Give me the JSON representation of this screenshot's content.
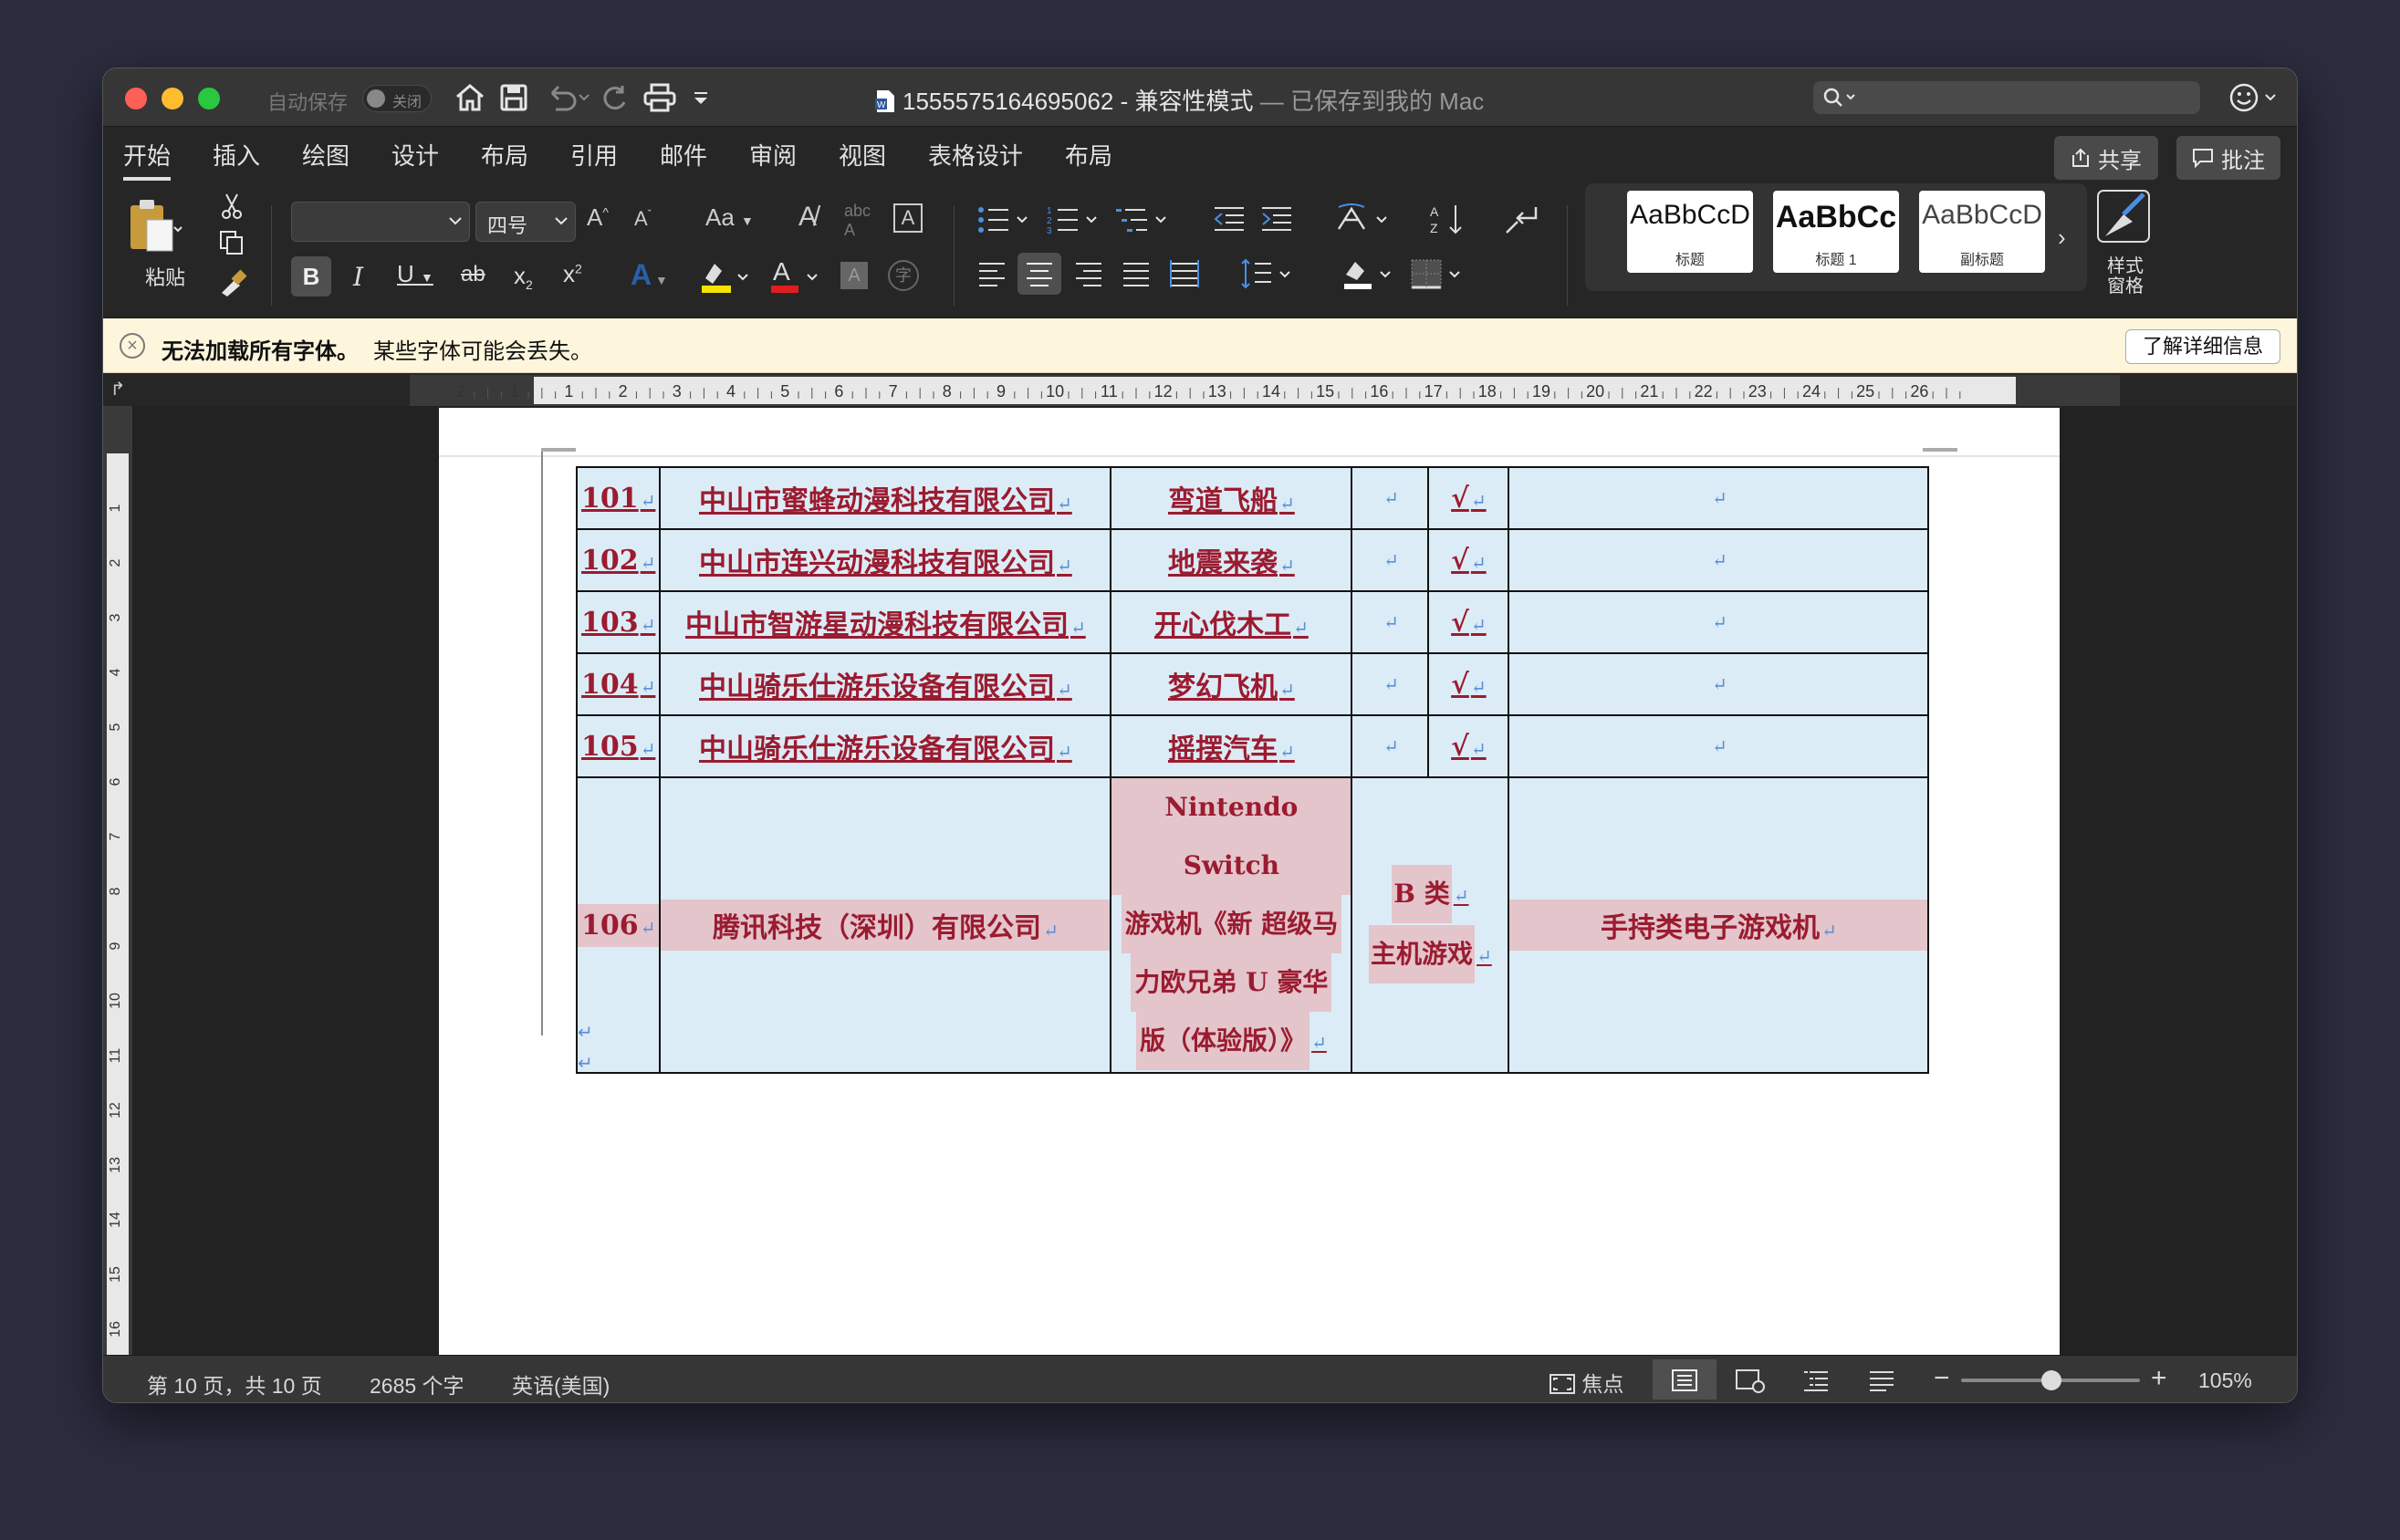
{
  "titlebar": {
    "autosave_label": "自动保存",
    "autosave_state": "关闭",
    "filename": "1555575164695062",
    "mode": "兼容性模式",
    "saved_status": "— 已保存到我的 Mac"
  },
  "tabs": [
    "开始",
    "插入",
    "绘图",
    "设计",
    "布局",
    "引用",
    "邮件",
    "审阅",
    "视图",
    "表格设计",
    "布局"
  ],
  "actions": {
    "share": "共享",
    "comment": "批注"
  },
  "ribbon": {
    "paste_label": "粘贴",
    "font_name": "",
    "font_size": "四号",
    "styles": [
      {
        "sample": "AaBbCcD",
        "name": "标题"
      },
      {
        "sample": "AaBbCc",
        "name": "标题 1"
      },
      {
        "sample": "AaBbCcD",
        "name": "副标题"
      }
    ],
    "styles_pane_label": "样式\n窗格"
  },
  "notice": {
    "title": "无法加载所有字体。",
    "message": "某些字体可能会丢失。",
    "button": "了解详细信息"
  },
  "ruler_numbers": [
    "2",
    "1",
    "1",
    "2",
    "3",
    "4",
    "5",
    "6",
    "7",
    "8",
    "9",
    "10",
    "11",
    "12",
    "13",
    "14",
    "15",
    "16",
    "17",
    "18",
    "19",
    "20",
    "21",
    "22",
    "23",
    "24",
    "25",
    "26"
  ],
  "table": {
    "rows": [
      {
        "no": "101",
        "company": "中山市蜜蜂动漫科技有限公司",
        "product": "弯道飞船",
        "class": "",
        "check": "√",
        "note": ""
      },
      {
        "no": "102",
        "company": "中山市连兴动漫科技有限公司",
        "product": "地震来袭",
        "class": "",
        "check": "√",
        "note": ""
      },
      {
        "no": "103",
        "company": "中山市智游星动漫科技有限公司",
        "product": "开心伐木工",
        "class": "",
        "check": "√",
        "note": ""
      },
      {
        "no": "104",
        "company": "中山骑乐仕游乐设备有限公司",
        "product": "梦幻飞机",
        "class": "",
        "check": "√",
        "note": ""
      },
      {
        "no": "105",
        "company": "中山骑乐仕游乐设备有限公司",
        "product": "摇摆汽车",
        "class": "",
        "check": "√",
        "note": ""
      }
    ],
    "last_row": {
      "no": "106",
      "company": "腾讯科技（深圳）有限公司",
      "product_lines": [
        "Nintendo Switch",
        "游戏机《新 超级马",
        "力欧兄弟 U 豪华",
        "版（体验版）》"
      ],
      "class_lines": [
        "B 类",
        "主机游戏"
      ],
      "note": "手持类电子游戏机"
    }
  },
  "status": {
    "page": "第 10 页，共 10 页",
    "words": "2685 个字",
    "language": "英语(美国)",
    "focus": "焦点",
    "zoom": "105%"
  }
}
